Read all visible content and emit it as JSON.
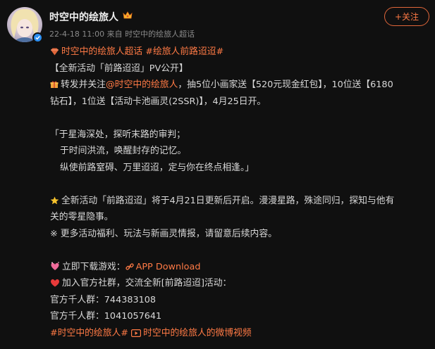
{
  "user": {
    "name": "时空中的绘旅人",
    "meta": "22-4-18 11:00  来自 时空中的绘旅人超话"
  },
  "follow_label": "+关注",
  "post": {
    "l1_tags": "时空中的绘旅人超话 #绘旅人前路迢迢#",
    "l2": "【全新活动「前路迢迢」PV公开】",
    "l3_a": "转发并关注",
    "l3_mention": "@时空中的绘旅人",
    "l3_b": "，抽5位小画家送【520元现金红包】，10位送【6180",
    "l4": "钻石】，1位送【活动卡池画灵(2SSR)】，4月25日开。",
    "q1": "「于星海深处，探听末路的审判；",
    "q2": "于时间洪流，唤醒封存的记忆。",
    "q3": "纵使前路窒碍、万里迢迢，定与你在终点相逢。」",
    "s1": "全新活动「前路迢迢」将于4月21日更新后开启。漫漫星路，殊途同归，探知与他有",
    "s2": "关的零星隐事。",
    "s3": "※ 更多活动福利、玩法与新画灵情报，请留意后续内容。",
    "d1_a": "立即下载游戏：",
    "d1_link": "APP Download",
    "d2": "加入官方社群，交流全新[前路迢迢]活动：",
    "g1": "官方千人群：744383108",
    "g2": "官方千人群：1041057641",
    "f_tag": "#时空中的绘旅人#",
    "f_video": "时空中的绘旅人的微博视频"
  },
  "colors": {
    "accent": "#ff7a45",
    "text": "#d9d9d9",
    "muted": "#8a8a8a",
    "bg": "#101010"
  }
}
